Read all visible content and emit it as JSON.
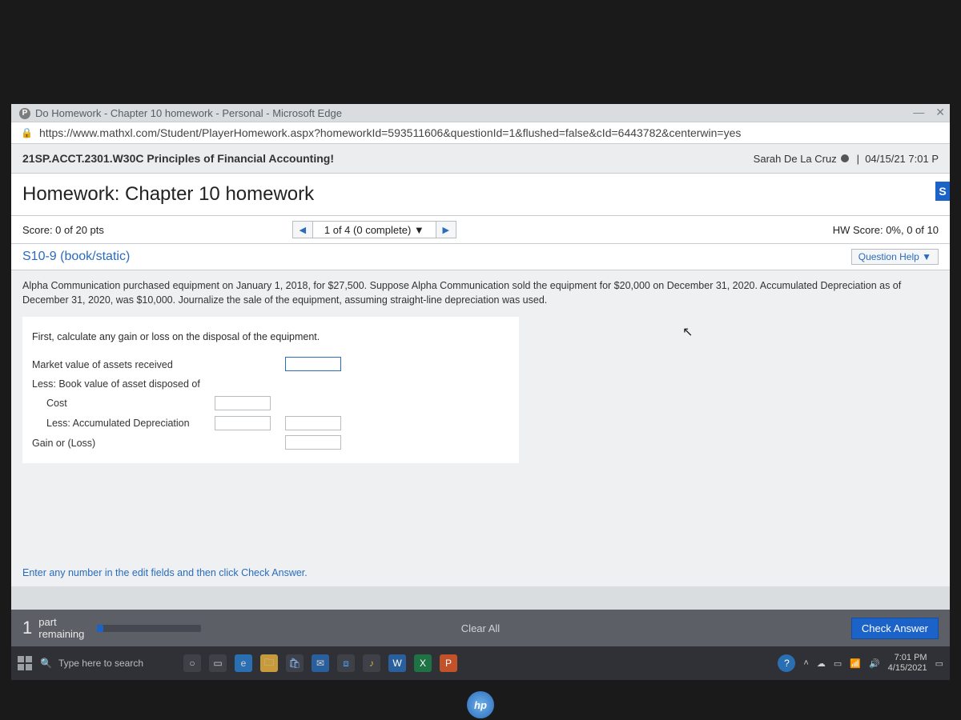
{
  "window": {
    "title": "Do Homework - Chapter 10 homework - Personal - Microsoft Edge",
    "url": "https://www.mathxl.com/Student/PlayerHomework.aspx?homeworkId=593511606&questionId=1&flushed=false&cId=6443782&centerwin=yes"
  },
  "course": {
    "name": "21SP.ACCT.2301.W30C Principles of Financial Accounting!",
    "user": "Sarah De La Cruz",
    "datetime": "04/15/21 7:01 P"
  },
  "hw": {
    "title": "Homework: Chapter 10 homework",
    "score": "Score: 0 of 20 pts",
    "progress": "1 of 4 (0 complete) ▼",
    "hwscore": "HW Score: 0%, 0 of 10",
    "question_id": "S10-9 (book/static)",
    "help_label": "Question Help ▼",
    "save_chip": "S"
  },
  "question": {
    "prompt": "Alpha Communication purchased equipment on January 1, 2018, for $27,500. Suppose Alpha Communication sold the equipment for $20,000 on December 31, 2020. Accumulated Depreciation as of December 31, 2020, was $10,000. Journalize the sale of the equipment, assuming straight-line depreciation was used.",
    "step": "First, calculate any gain or loss on the disposal of the equipment.",
    "rows": {
      "mv": "Market value of assets received",
      "bv": "Less: Book value of asset disposed of",
      "cost": "Cost",
      "accdep": "Less: Accumulated Depreciation",
      "gain": "Gain or (Loss)"
    },
    "hint": "Enter any number in the edit fields and then click Check Answer."
  },
  "footer": {
    "parts_num": "1",
    "parts_label_line1": "part",
    "parts_label_line2": "remaining",
    "clear": "Clear All",
    "check": "Check Answer"
  },
  "taskbar": {
    "search_placeholder": "Type here to search",
    "time": "7:01 PM",
    "date": "4/15/2021"
  },
  "hp": "hp"
}
